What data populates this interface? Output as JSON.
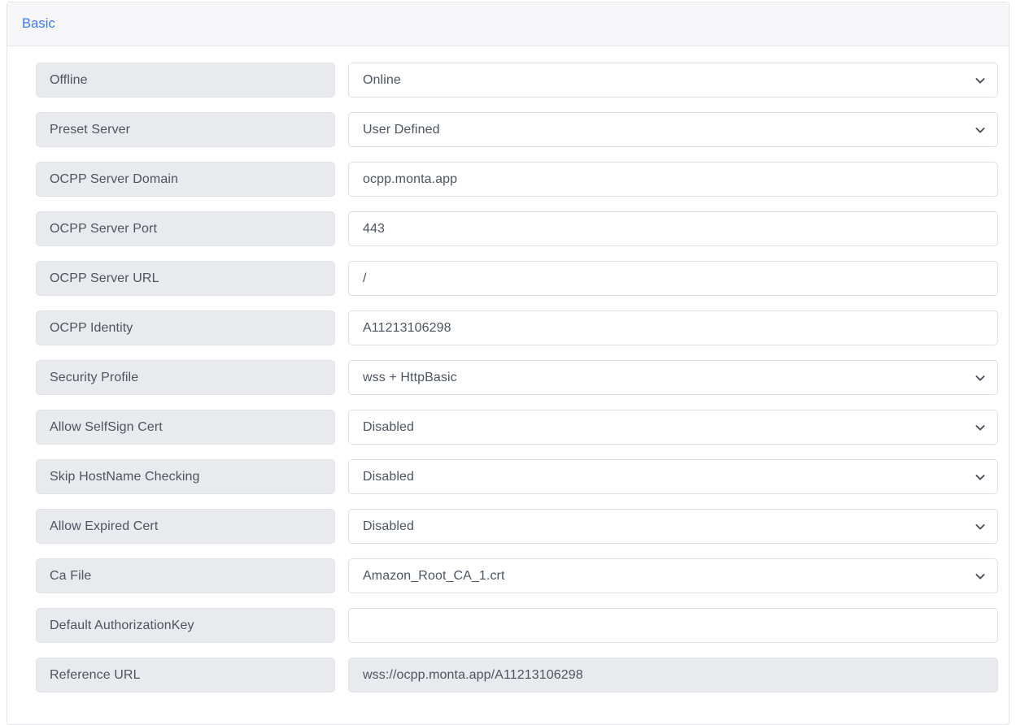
{
  "card": {
    "header": {
      "link_label": "Basic"
    },
    "rows": [
      {
        "label": "Offline",
        "value": "Online",
        "control": "select",
        "readonly": false
      },
      {
        "label": "Preset Server",
        "value": "User Defined",
        "control": "select",
        "readonly": false
      },
      {
        "label": "OCPP Server Domain",
        "value": "ocpp.monta.app",
        "control": "text",
        "readonly": false,
        "annotation_arrow": {
          "length": 160
        }
      },
      {
        "label": "OCPP Server Port",
        "value": "443",
        "control": "text",
        "readonly": false,
        "annotation_arrow": {
          "length": 160
        }
      },
      {
        "label": "OCPP Server URL",
        "value": "/",
        "control": "text",
        "readonly": false,
        "annotation_arrow": {
          "length": 155
        }
      },
      {
        "label": "OCPP Identity",
        "value": "A11213106298",
        "control": "text",
        "readonly": false,
        "annotation_arrow": {
          "length": 155
        }
      },
      {
        "label": "Security Profile",
        "value": "wss + HttpBasic",
        "control": "select",
        "readonly": false
      },
      {
        "label": "Allow SelfSign Cert",
        "value": "Disabled",
        "control": "select",
        "readonly": false
      },
      {
        "label": "Skip HostName Checking",
        "value": "Disabled",
        "control": "select",
        "readonly": false
      },
      {
        "label": "Allow Expired Cert",
        "value": "Disabled",
        "control": "select",
        "readonly": false
      },
      {
        "label": "Ca File",
        "value": "Amazon_Root_CA_1.crt",
        "control": "select",
        "readonly": false
      },
      {
        "label": "Default AuthorizationKey",
        "value": "",
        "control": "text",
        "readonly": false
      },
      {
        "label": "Reference URL",
        "value": "wss://ocpp.monta.app/A11213106298",
        "control": "text",
        "readonly": true
      }
    ]
  },
  "icons": {
    "chevron_down": "chevron-down-icon",
    "annotation_arrow": "left-arrow-annotation-icon"
  },
  "colors": {
    "header_link": "#3c78f0",
    "label_background": "#e8eaee",
    "field_border": "#dde0e5",
    "text": "#4c545f",
    "annotation_arrow": "#1f28e0"
  }
}
